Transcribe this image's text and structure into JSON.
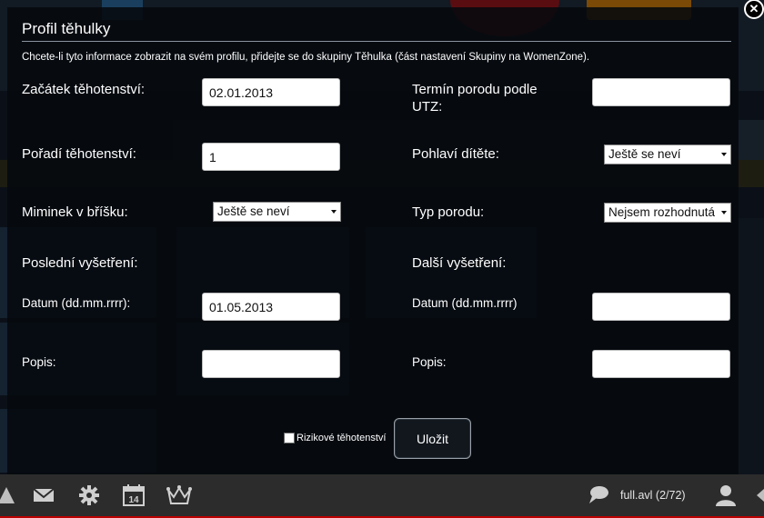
{
  "modal": {
    "title": "Profil těhulky",
    "info": "Chcete-li tyto informace zobrazit na svém profilu, přidejte se do skupiny Těhulka (část nastavení Skupiny na WomenZone).",
    "close_icon": "close-icon"
  },
  "form": {
    "start_label": "Začátek těhotenství:",
    "start_value": "02.01.2013",
    "due_label": "Termín porodu podle UTZ:",
    "due_value": "",
    "order_label": "Pořadí těhotenství:",
    "order_value": "1",
    "sex_label": "Pohlaví dítěte:",
    "sex_value": "Ještě se neví",
    "babies_label": "Miminek v bříšku:",
    "babies_value": "Ještě se neví",
    "birth_type_label": "Typ porodu:",
    "birth_type_value": "Nejsem rozhodnutá",
    "last_exam_label": "Poslední vyšetření:",
    "next_exam_label": "Další vyšetření:",
    "date_label_left": "Datum (dd.mm.rrrr):",
    "date_value_left": "01.05.2013",
    "date_label_right": "Datum (dd.mm.rrrr)",
    "date_value_right": "",
    "desc_label_left": "Popis:",
    "desc_value_left": "",
    "desc_label_right": "Popis:",
    "desc_value_right": "",
    "risk_label": "Rizikové těhotenství",
    "risk_checked": false,
    "save_label": "Uložit"
  },
  "bottom_bar": {
    "icons": [
      "mail-icon",
      "gear-icon",
      "calendar-icon",
      "crown-icon",
      "chat-icon",
      "user-icon"
    ],
    "calendar_day": "14",
    "user_status": "full.avl (2/72)"
  }
}
